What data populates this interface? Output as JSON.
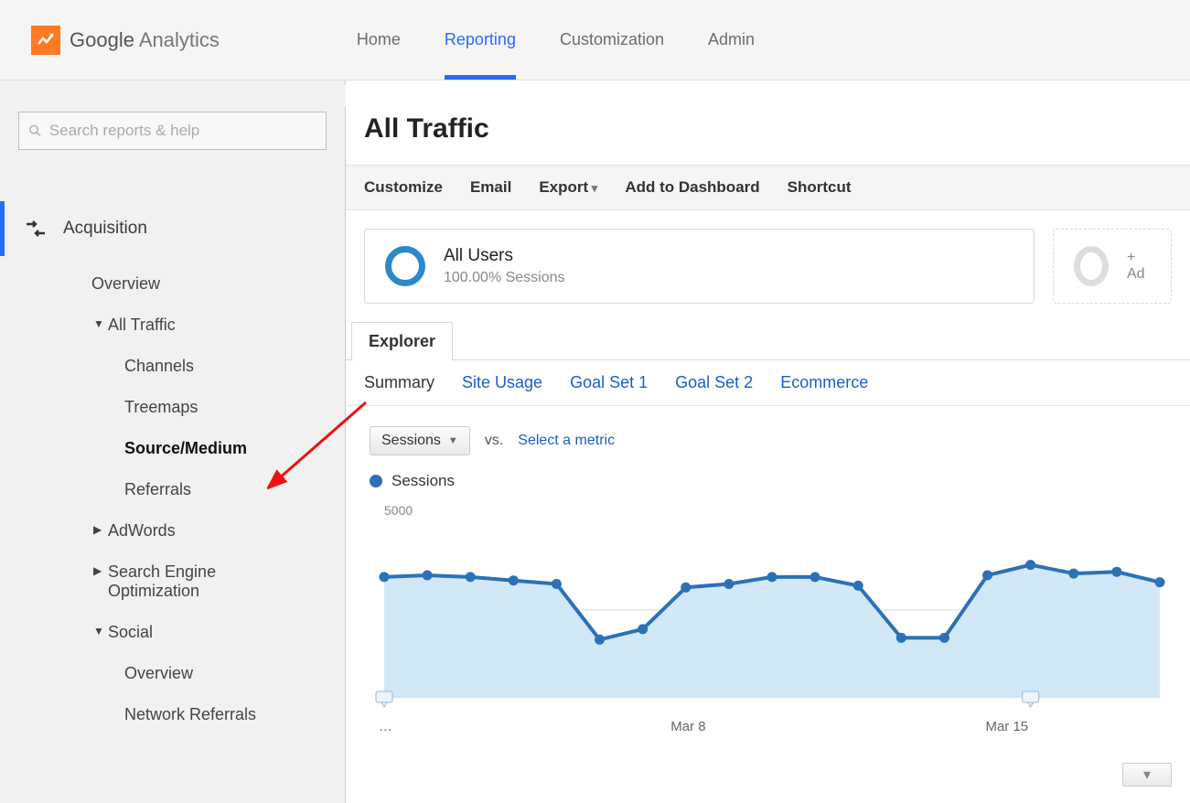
{
  "brand": {
    "bold": "Google",
    "thin": " Analytics"
  },
  "nav": {
    "items": [
      "Home",
      "Reporting",
      "Customization",
      "Admin"
    ],
    "activeIndex": 1
  },
  "sidebar": {
    "search_placeholder": "Search reports & help",
    "section": "Acquisition",
    "items": [
      {
        "label": "Overview",
        "level": 1
      },
      {
        "label": "All Traffic",
        "level": 1,
        "caret": "down"
      },
      {
        "label": "Channels",
        "level": 2
      },
      {
        "label": "Treemaps",
        "level": 2
      },
      {
        "label": "Source/Medium",
        "level": 2,
        "bold": true
      },
      {
        "label": "Referrals",
        "level": 2
      },
      {
        "label": "AdWords",
        "level": 1,
        "caret": "right"
      },
      {
        "label": "Search Engine Optimization",
        "level": 1,
        "caret": "right"
      },
      {
        "label": "Social",
        "level": 1,
        "caret": "down"
      },
      {
        "label": "Overview",
        "level": 2
      },
      {
        "label": "Network Referrals",
        "level": 2
      }
    ]
  },
  "page": {
    "title": "All Traffic"
  },
  "toolbar": {
    "customize": "Customize",
    "email": "Email",
    "export": "Export",
    "add_dashboard": "Add to Dashboard",
    "shortcut": "Shortcut"
  },
  "segments": {
    "primary": {
      "title": "All Users",
      "subtitle": "100.00% Sessions"
    },
    "add_label": "+ Ad"
  },
  "explorer": {
    "tab": "Explorer",
    "subtabs": [
      "Summary",
      "Site Usage",
      "Goal Set 1",
      "Goal Set 2",
      "Ecommerce"
    ],
    "activeSubtab": 0,
    "metric_dropdown": "Sessions",
    "vs": "vs.",
    "select_metric": "Select a metric",
    "legend": "Sessions"
  },
  "chart_data": {
    "type": "line",
    "title": "",
    "xlabel": "",
    "ylabel": "",
    "ylim": [
      0,
      5000
    ],
    "y_ticks": [
      2500,
      5000
    ],
    "x_tick_labels": [
      "…",
      "Mar 8",
      "Mar 15"
    ],
    "x_tick_positions": [
      0.02,
      0.4,
      0.8
    ],
    "series": [
      {
        "name": "Sessions",
        "values": [
          3450,
          3500,
          3450,
          3350,
          3250,
          1650,
          1950,
          3150,
          3250,
          3450,
          3450,
          3200,
          1700,
          1700,
          3500,
          3800,
          3550,
          3600,
          3300
        ]
      }
    ],
    "annotations": [
      {
        "type": "marker",
        "x_index": 0
      },
      {
        "type": "marker",
        "x_index": 15
      }
    ]
  }
}
